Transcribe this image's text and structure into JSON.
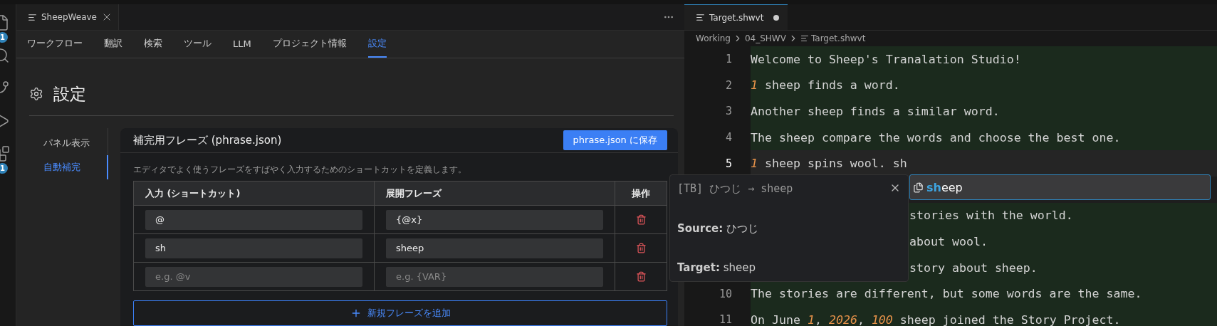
{
  "activity_bar": {
    "items": [
      {
        "kind": "files",
        "badge": "1"
      },
      {
        "kind": "search"
      },
      {
        "kind": "source-control"
      },
      {
        "kind": "run"
      },
      {
        "kind": "extensions",
        "badge": "1"
      }
    ]
  },
  "panel": {
    "tab": {
      "title": "SheepWeave"
    },
    "nav": [
      {
        "label": "ワークフロー",
        "selected": false
      },
      {
        "label": "翻訳",
        "selected": false
      },
      {
        "label": "検索",
        "selected": false
      },
      {
        "label": "ツール",
        "selected": false
      },
      {
        "label": "LLM",
        "selected": false
      },
      {
        "label": "プロジェクト情報",
        "selected": false
      },
      {
        "label": "設定",
        "selected": true
      }
    ],
    "page_title": "設定",
    "subnav": [
      {
        "label": "パネル表示",
        "selected": false
      },
      {
        "label": "自動補完",
        "selected": true
      }
    ],
    "card": {
      "title": "補完用フレーズ (phrase.json)",
      "save_button": "phrase.json に保存",
      "description": "エディタでよく使うフレーズをすばやく入力するためのショートカットを定義します。",
      "columns": [
        "入力 (ショートカット)",
        "展開フレーズ",
        "操作"
      ],
      "rows": [
        {
          "input": {
            "value": "@"
          },
          "phrase": {
            "value": "{@x}"
          }
        },
        {
          "input": {
            "value": "sh"
          },
          "phrase": {
            "value": "sheep"
          }
        },
        {
          "input": {
            "placeholder": "e.g. @v"
          },
          "phrase": {
            "placeholder": "e.g. {VAR}"
          }
        }
      ],
      "add_button": "新規フレーズを追加"
    }
  },
  "editor": {
    "tab": {
      "title": "Target.shwvt",
      "dirty": true
    },
    "breadcrumb": [
      "Working",
      "04_SHWV",
      "Target.shwvt"
    ],
    "lines": [
      {
        "number": "1",
        "text": "Welcome to Sheep's Tranalation Studio!",
        "current": false,
        "covered": false
      },
      {
        "number": "2",
        "text": "*1* sheep finds a word.",
        "current": false,
        "covered": false
      },
      {
        "number": "3",
        "text": "Another sheep finds a similar word.",
        "current": false,
        "covered": false
      },
      {
        "number": "4",
        "text": "The sheep compare the words and choose the best one.",
        "current": false,
        "covered": false
      },
      {
        "number": "5",
        "text": "*1* sheep spins wool. sh",
        "current": true,
        "covered": false
      },
      {
        "text": "stories with the world.",
        "current": false,
        "covered": true
      },
      {
        "text": "about wool.",
        "current": false,
        "covered": true
      },
      {
        "text": "story about sheep.",
        "current": false,
        "covered": true
      },
      {
        "number": "10",
        "text": "The stories are different, but some words are the same.",
        "current": false,
        "covered": false
      },
      {
        "number": "11",
        "text": "On June *1*, *2026*, *100* sheep joined the Story Project.",
        "current": false,
        "covered": false
      }
    ],
    "hover": {
      "header": "[TB] ひつじ → sheep",
      "source": "**Source:** ひつじ",
      "target": "**Target:** sheep"
    },
    "suggestion": {
      "label": "**sh**eep"
    }
  }
}
